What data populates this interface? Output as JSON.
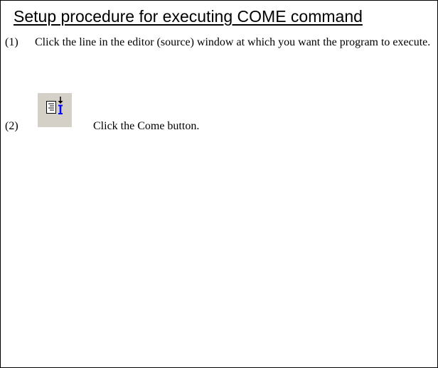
{
  "title": "Setup procedure for executing COME command",
  "steps": [
    {
      "number": "(1)",
      "text": "Click the line in the editor (source) window at which you want the program to execute."
    },
    {
      "number": "(2)",
      "text": "Click the Come button."
    }
  ],
  "icons": {
    "come_button": "come-icon"
  },
  "colors": {
    "text": "#000000",
    "button_face": "#d4d0c8",
    "icon_accent": "#0000ff"
  }
}
